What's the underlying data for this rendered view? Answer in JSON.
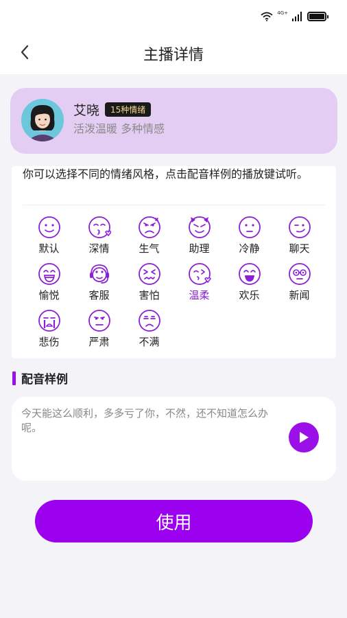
{
  "status_bar": {
    "network_label": "4G+"
  },
  "header": {
    "title": "主播详情"
  },
  "profile": {
    "name": "艾晓",
    "badge": "15种情绪",
    "description": "活泼温暖 多种情感"
  },
  "emotions": {
    "intro": "你可以选择不同的情绪风格，点击配音样例的播放键试听。",
    "accent_color": "#8b1ed6",
    "items": [
      {
        "label": "默认",
        "icon": "face-smile-icon"
      },
      {
        "label": "深情",
        "icon": "face-kiss-heart-icon"
      },
      {
        "label": "生气",
        "icon": "face-angry-icon"
      },
      {
        "label": "助理",
        "icon": "face-devil-icon"
      },
      {
        "label": "冷静",
        "icon": "face-calm-icon"
      },
      {
        "label": "聊天",
        "icon": "face-smirk-icon"
      },
      {
        "label": "愉悦",
        "icon": "face-laugh-icon"
      },
      {
        "label": "客服",
        "icon": "face-headset-icon"
      },
      {
        "label": "害怕",
        "icon": "face-scared-icon"
      },
      {
        "label": "温柔",
        "icon": "face-wink-heart-icon",
        "selected": true
      },
      {
        "label": "欢乐",
        "icon": "face-joy-icon"
      },
      {
        "label": "新闻",
        "icon": "face-glasses-icon"
      },
      {
        "label": "悲伤",
        "icon": "face-cry-icon"
      },
      {
        "label": "严肃",
        "icon": "face-serious-icon"
      },
      {
        "label": "不满",
        "icon": "face-displeased-icon"
      }
    ]
  },
  "sample": {
    "section_title": "配音样例",
    "text": "今天能这么顺利，多多亏了你，不然，还不知道怎么办呢。"
  },
  "actions": {
    "use_label": "使用"
  },
  "colors": {
    "brand": "#9b00ef",
    "card_bg": "#e4cdf3",
    "page_bg": "#f4f3f8"
  }
}
